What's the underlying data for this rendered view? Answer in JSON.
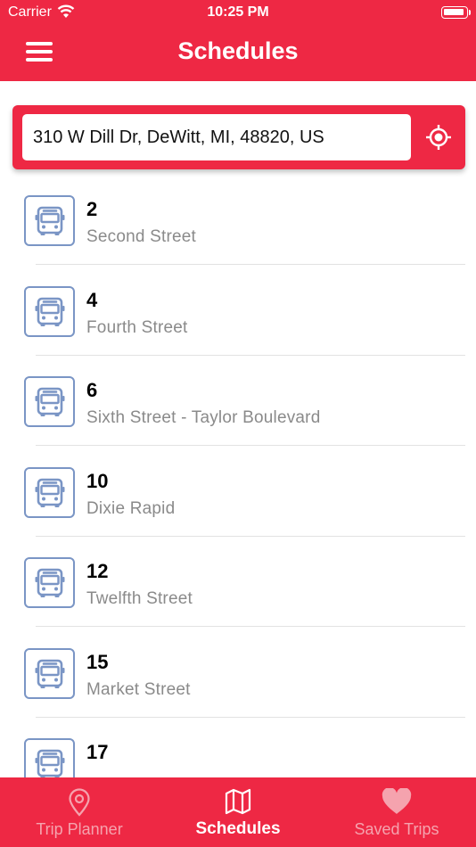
{
  "status_bar": {
    "carrier": "Carrier",
    "time": "10:25 PM"
  },
  "header": {
    "title": "Schedules"
  },
  "search": {
    "value": "310 W Dill Dr, DeWitt, MI, 48820, US"
  },
  "routes": [
    {
      "number": "2",
      "name": "Second Street"
    },
    {
      "number": "4",
      "name": "Fourth Street"
    },
    {
      "number": "6",
      "name": "Sixth Street - Taylor Boulevard"
    },
    {
      "number": "10",
      "name": "Dixie Rapid"
    },
    {
      "number": "12",
      "name": "Twelfth Street"
    },
    {
      "number": "15",
      "name": "Market Street"
    },
    {
      "number": "17",
      "name": ""
    }
  ],
  "tabs": [
    {
      "label": "Trip Planner",
      "icon": "map-pin-icon",
      "active": false
    },
    {
      "label": "Schedules",
      "icon": "map-icon",
      "active": true
    },
    {
      "label": "Saved Trips",
      "icon": "heart-icon",
      "active": false
    }
  ],
  "colors": {
    "brand": "#EE2844",
    "icon_blue": "#7A95C5",
    "secondary_text": "#8a8a8a",
    "inactive_tab": "#F5A3AE"
  }
}
